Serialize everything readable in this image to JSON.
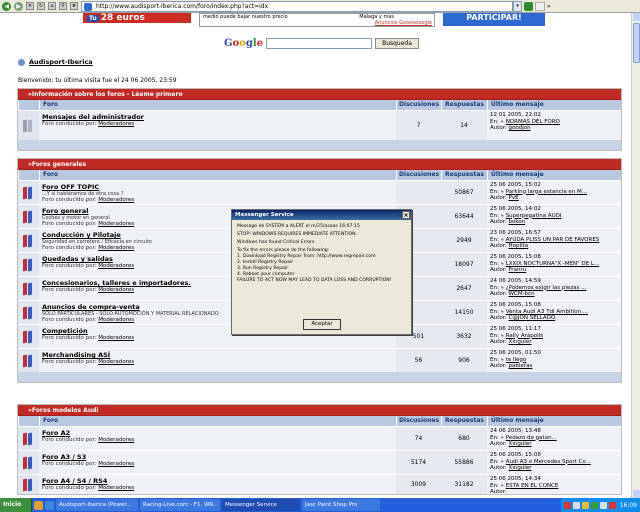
{
  "browser": {
    "address": "http://www.audisport-iberica.com/foro/index.php?act=idx",
    "addr_go": "▾",
    "links_label": "»"
  },
  "banners": {
    "left_tag": "Tu",
    "left_text": "28 euros",
    "middle_line1_a": "medio puede bajar nuestro precio",
    "middle_line1_b": "Malaga y mas",
    "middle_link": "Anuncios Gooooooogle",
    "right_text": "PARTICIPAR!"
  },
  "search": {
    "logo_parts": [
      "G",
      "o",
      "o",
      "g",
      "l",
      "e"
    ],
    "button": "Busqueda"
  },
  "site": {
    "name": "Audisport-Iberica",
    "welcome": "Bienvenido; tu última visita fue el 24 06 2005, 23:59"
  },
  "columns": {
    "forum": "Foro",
    "discussions": "Discusiones",
    "responses": "Respuestas",
    "last": "Último mensaje"
  },
  "sections": [
    {
      "title": "Información sobre los foros - Léeme primero",
      "forums": [
        {
          "title": "Mensajes del administrador",
          "desc": "",
          "mod_prefix": "Foro conducido por:",
          "mod": "Moderadores",
          "disc": "7",
          "resp": "14",
          "lp_date": "12 01 2005, 22:02",
          "lp_in_prefix": "En: »",
          "lp_topic": "NORMAS DEL FORO",
          "lp_by_prefix": "Autor:",
          "lp_author": "goodjon",
          "read": true
        }
      ]
    },
    {
      "title": "Foros generales",
      "forums": [
        {
          "title": "Foro OFF TOPIC",
          "desc": "...Y si hablaramos de otra cosa ?",
          "mod_prefix": "Foro conducido por:",
          "mod": "Moderadores",
          "disc": "",
          "resp": "50867",
          "lp_date": "25 06 2005, 15:02",
          "lp_in_prefix": "En: »",
          "lp_topic": "Parking larga estancia en M...",
          "lp_by_prefix": "Autor:",
          "lp_author": "PvE",
          "read": false
        },
        {
          "title": "Foro general",
          "desc": "Coches y motor en general",
          "mod_prefix": "Foro conducido por:",
          "mod": "Moderadores",
          "disc": "",
          "resp": "63644",
          "lp_date": "25 06 2005, 14:02",
          "lp_in_prefix": "En: »",
          "lp_topic": "Superpegatina AUDI",
          "lp_by_prefix": "Autor:",
          "lp_author": "bokon",
          "read": false
        },
        {
          "title": "Conducción y Pilotaje",
          "desc": "Seguridad en carretera / Eficacia en circuito",
          "mod_prefix": "Foro conducido por:",
          "mod": "Moderadores",
          "disc": "",
          "resp": "2949",
          "lp_date": "23 06 2005, 16:57",
          "lp_in_prefix": "En: »",
          "lp_topic": "AYUDA PLISS UN PAR DE FAVORES",
          "lp_by_prefix": "Autor:",
          "lp_author": "Hoplita",
          "read": false
        },
        {
          "title": "Quedadas y salidas",
          "desc": "",
          "mod_prefix": "Foro conducido por:",
          "mod": "Moderadores",
          "disc": "",
          "resp": "18097",
          "lp_date": "25 06 2005, 15:08",
          "lp_in_prefix": "En: »",
          "lp_topic": "LXXIX NOCTURNA\"X -MEN\" DE L...",
          "lp_by_prefix": "Autor:",
          "lp_author": "Franru",
          "read": false
        },
        {
          "title": "Concesionarios, talleres e importadores.",
          "desc": "",
          "mod_prefix": "Foro conducido por:",
          "mod": "Moderadores",
          "disc": "",
          "resp": "2647",
          "lp_date": "24 06 2005, 14:59",
          "lp_in_prefix": "En: »",
          "lp_topic": "¿Podemos exigir las piezas ...",
          "lp_by_prefix": "Autor:",
          "lp_author": "WCM-bcn",
          "read": false
        },
        {
          "title": "Anuncios de compra-venta",
          "desc": "SOLO PARTICULARES - SOLO AUTOMOCIÓN Y MATERIAL RELACIONADO",
          "mod_prefix": "Foro conducido por:",
          "mod": "Moderadores",
          "disc": "",
          "resp": "14150",
          "lp_date": "25 06 2005, 15:08",
          "lp_in_prefix": "En: »",
          "lp_topic": "Venta Audi A3 Tdí Ambition ...",
          "lp_by_prefix": "Autor:",
          "lp_author": "C@JON SELLADO",
          "read": false
        },
        {
          "title": "Competición",
          "desc": "",
          "mod_prefix": "Foro conducido por:",
          "mod": "Moderadores",
          "disc": "501",
          "resp": "3632",
          "lp_date": "25 06 2005, 11:17",
          "lp_in_prefix": "En: »",
          "lp_topic": "Rally Arápolis",
          "lp_by_prefix": "Autor:",
          "lp_author": "Xinguler",
          "read": false
        },
        {
          "title": "Merchandising ASÍ",
          "desc": "",
          "mod_prefix": "Foro conducido por:",
          "mod": "Moderadores",
          "disc": "56",
          "resp": "906",
          "lp_date": "25 06 2005, 01:50",
          "lp_in_prefix": "En: »",
          "lp_topic": "te llego",
          "lp_by_prefix": "Autor:",
          "lp_author": "pableras",
          "read": false
        }
      ]
    },
    {
      "title": "Foros modelos Audi",
      "forums": [
        {
          "title": "Foro A2",
          "desc": "",
          "mod_prefix": "Foro conducido por:",
          "mod": "Moderadores",
          "disc": "74",
          "resp": "680",
          "lp_date": "24 06 2005, 13:48",
          "lp_in_prefix": "En: »",
          "lp_topic": "Pedazo de gatan...",
          "lp_by_prefix": "Autor:",
          "lp_author": "Xinguler",
          "read": false
        },
        {
          "title": "Foro A3 / S3",
          "desc": "",
          "mod_prefix": "Foro conducido por:",
          "mod": "Moderadores",
          "disc": "5174",
          "resp": "55886",
          "lp_date": "25 06 2005, 15:08",
          "lp_in_prefix": "En: »",
          "lp_topic": "Audi A3 o Mercedes Sport Co...",
          "lp_by_prefix": "Autor:",
          "lp_author": "Xinguler",
          "read": false
        },
        {
          "title": "Foro A4 / S4 / RS4",
          "desc": "",
          "mod_prefix": "Foro conducido por:",
          "mod": "Moderadores",
          "disc": "3009",
          "resp": "31182",
          "lp_date": "25 06 2005, 14:34",
          "lp_in_prefix": "En: »",
          "lp_topic": "ESTA EN EL CONCE",
          "lp_by_prefix": "Autor:",
          "lp_author": "",
          "read": false
        }
      ]
    }
  ],
  "popup": {
    "title": "Messenger Service",
    "close": "×",
    "line1": "Message de SYSTEM a ALERT el m/25/asaas 16:07:15",
    "line2": "STOP! WINDOWS REQUIRES IMMEDIATE ATTENTION.",
    "line3": "Windows has found Critical Errors.",
    "steps_intro": "To fix the errors please do the following:",
    "step1": "1. Download Registry Repair from: http://www.regrepair.com",
    "step2": "2. Install Registry Repair",
    "step3": "3. Run Registry Repair",
    "step4": "4. Reboot your computer",
    "warning": "FAILURE TO ACT NOW MAY LEAD TO DATA LOSS AND CORRUPTION!",
    "ok": "Aceptar"
  },
  "taskbar": {
    "start": "Inicio",
    "tasks": [
      "Audisport-Iberica (Power...",
      "Racing-Live.com - F1, WR...",
      "Messenger Service",
      "Jasc Paint Shop Pro"
    ],
    "clock": "16:09"
  }
}
